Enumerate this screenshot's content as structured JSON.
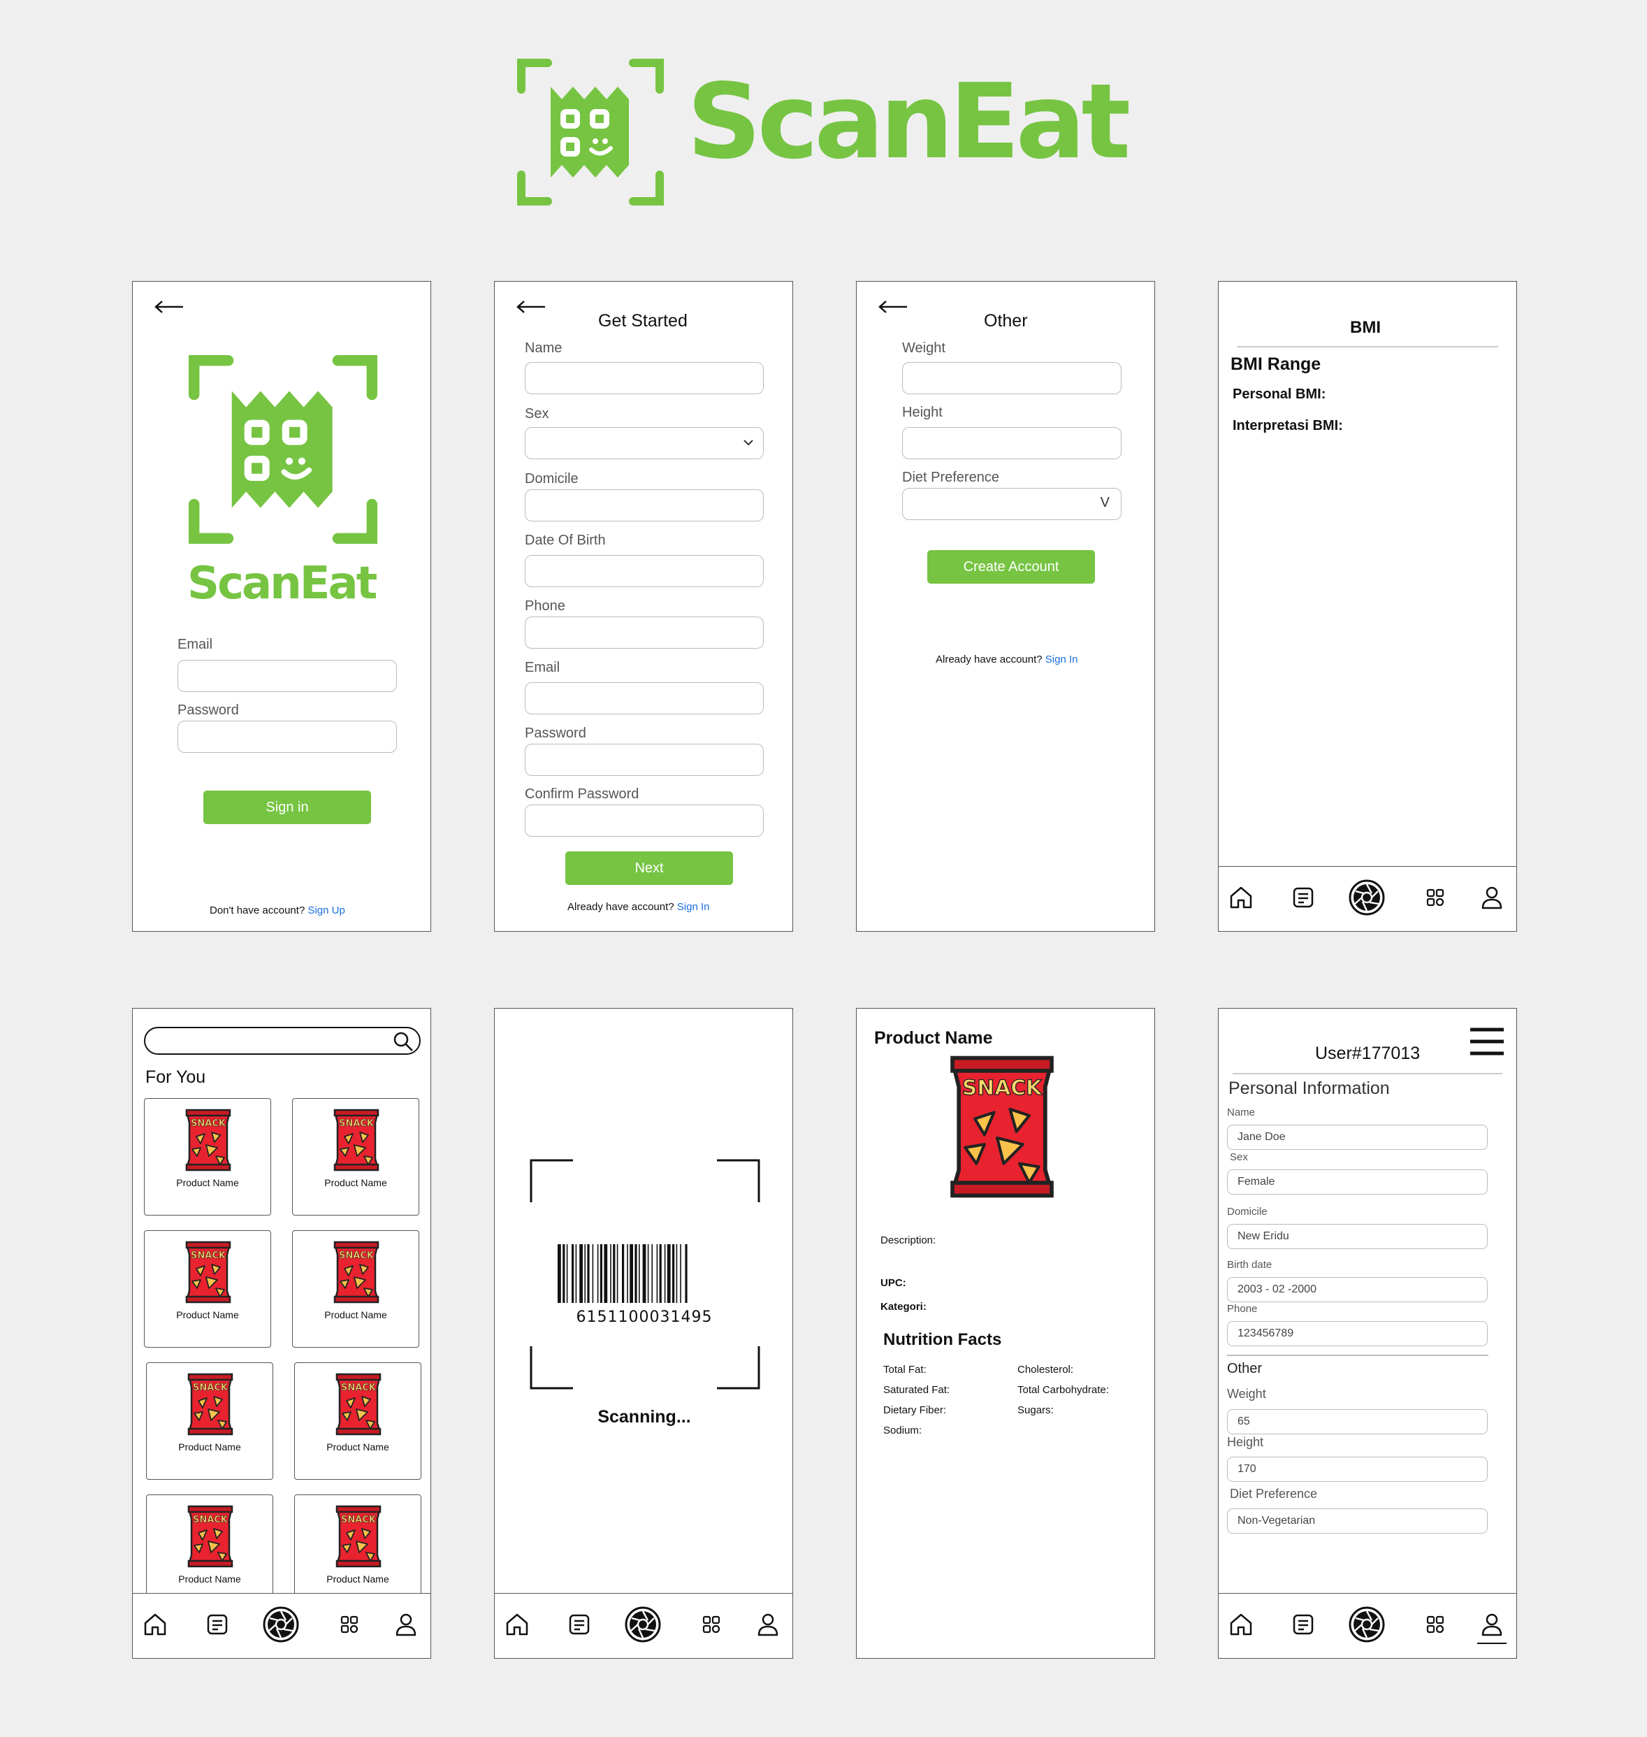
{
  "brand": {
    "name": "ScanEat",
    "color": "#76c442"
  },
  "login": {
    "email_label": "Email",
    "password_label": "Password",
    "signin_button": "Sign in",
    "footer_text": "Don't have account?",
    "footer_link": "Sign Up"
  },
  "get_started": {
    "title": "Get Started",
    "fields": [
      "Name",
      "Sex",
      "Domicile",
      "Date Of Birth",
      "Phone",
      "Email",
      "Password",
      "Confirm Password"
    ],
    "next_button": "Next",
    "footer_text": "Already have account?",
    "footer_link": "Sign In"
  },
  "other": {
    "title": "Other",
    "weight_label": "Weight",
    "height_label": "Height",
    "diet_label": "Diet Preference",
    "diet_caret": "V",
    "create_button": "Create Account",
    "footer_text": "Already have account?",
    "footer_link": "Sign In"
  },
  "bmi": {
    "title": "BMI",
    "range": "BMI Range",
    "personal": "Personal BMI:",
    "interpretation": "Interpretasi BMI:"
  },
  "home": {
    "section_title": "For You",
    "products": [
      "Product Name",
      "Product Name",
      "Product Name",
      "Product Name",
      "Product Name",
      "Product Name",
      "Product Name",
      "Product Name"
    ],
    "snack_label": "SNACK"
  },
  "scanner": {
    "barcode_number": "6151100031495",
    "status": "Scanning..."
  },
  "product": {
    "name": "Product Name",
    "snack_label": "SNACK",
    "description": "Description:",
    "upc": "UPC:",
    "kategori": "Kategori:",
    "nutrition_title": "Nutrition Facts",
    "nutrition_left": [
      "Total Fat:",
      "Saturated Fat:",
      "Dietary Fiber:",
      "Sodium:"
    ],
    "nutrition_right": [
      "Cholesterol:",
      "Total Carbohydrate:",
      "Sugars:"
    ]
  },
  "profile": {
    "user": "User#177013",
    "personal_title": "Personal Information",
    "name_label": "Name",
    "name": "Jane Doe",
    "sex_label": "Sex",
    "sex": "Female",
    "domicile_label": "Domicile",
    "domicile": "New Eridu",
    "birth_label": "Birth date",
    "birth": "2003 - 02 -2000",
    "phone_label": "Phone",
    "phone": "123456789",
    "other_title": "Other",
    "weight_label": "Weight",
    "weight": "65",
    "height_label": "Height",
    "height": "170",
    "diet_label": "Diet Preference",
    "diet": "Non-Vegetarian"
  },
  "nav_icons": [
    "home-icon",
    "notes-icon",
    "camera-shutter-icon",
    "grid-icon",
    "profile-icon"
  ]
}
